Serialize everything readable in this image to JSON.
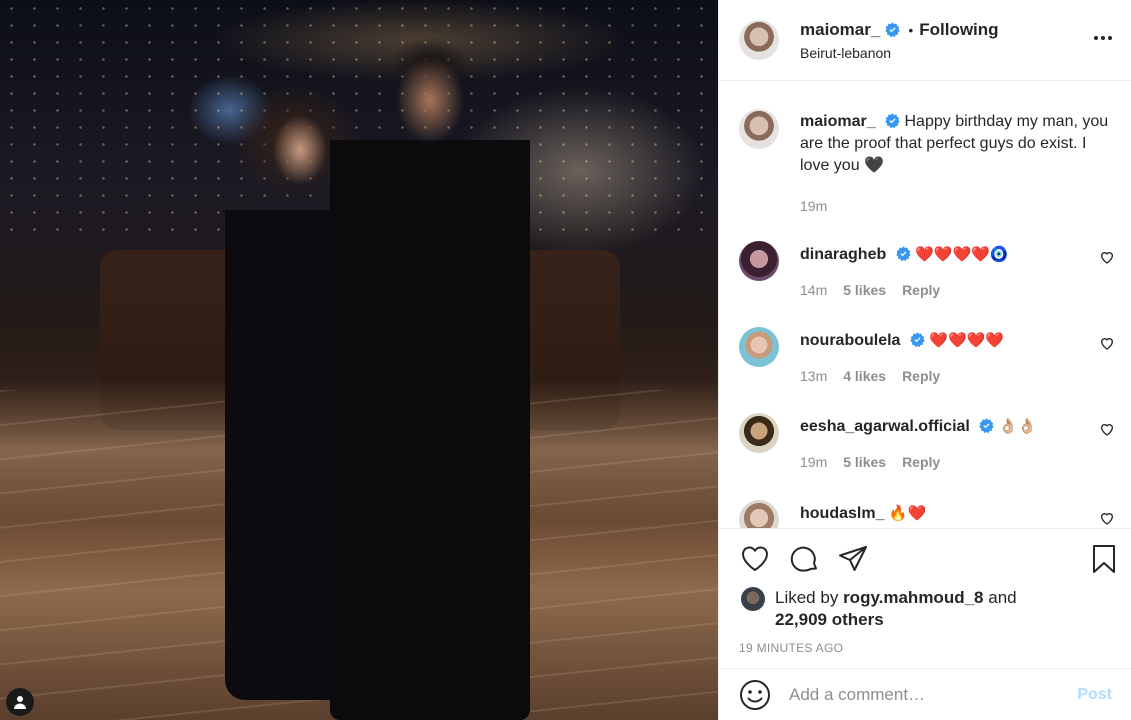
{
  "post": {
    "username": "maiomar_",
    "location": "Beirut-lebanon",
    "follow_status": "Following",
    "separator": "•",
    "caption": "Happy birthday my man, you are the proof that perfect guys do exist. I love you 🖤",
    "caption_time": "19m"
  },
  "comments": [
    {
      "username": "dinaragheb",
      "text": "❤️❤️❤️❤️🧿",
      "time": "14m",
      "likes": "5 likes",
      "reply": "Reply"
    },
    {
      "username": "nouraboulela",
      "text": "❤️❤️❤️❤️",
      "time": "13m",
      "likes": "4 likes",
      "reply": "Reply"
    },
    {
      "username": "eesha_agarwal.official",
      "text": "👌🏼👌🏼",
      "time": "19m",
      "likes": "5 likes",
      "reply": "Reply"
    },
    {
      "username": "houdaslm_",
      "text": "🔥❤️",
      "time": "",
      "likes": "",
      "reply": ""
    }
  ],
  "likes": {
    "prefix": "Liked by",
    "user": "rogy.mahmoud_8",
    "connector": "and",
    "others": "22,909 others"
  },
  "timestamp": "19 MINUTES AGO",
  "add_comment": {
    "placeholder": "Add a comment…",
    "post_label": "Post"
  },
  "colors": {
    "verified": "#3897f0",
    "heart": "#ed4956",
    "post_disabled": "#b3dbff",
    "meta": "#8e8e8e"
  }
}
